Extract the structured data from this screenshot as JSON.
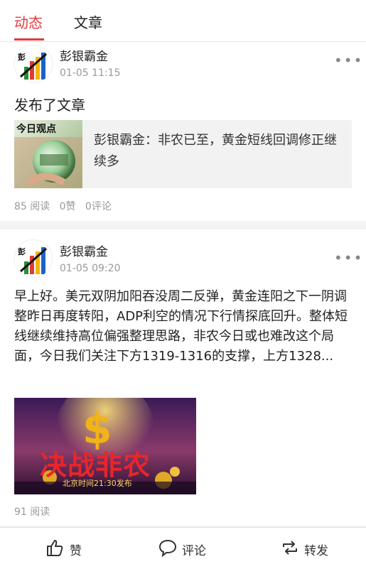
{
  "tabs": [
    {
      "label": "动态",
      "active": true
    },
    {
      "label": "文章",
      "active": false
    }
  ],
  "posts": [
    {
      "author": "彭银霸金",
      "time": "01-05 11:15",
      "action": "发布了文章",
      "article": {
        "thumb_title": "今日观点",
        "title": "彭银霸金：非农已至，黄金短线回调修正继续多"
      },
      "stats": {
        "reads": "85 阅读",
        "likes": "0赞",
        "comments": "0评论"
      }
    },
    {
      "author": "彭银霸金",
      "time": "01-05 09:20",
      "body": "早上好。美元双阴加阳吞没周二反弹，黄金连阳之下一阴调整昨日再度转阳，ADP利空的情况下行情探底回升。整体短线继续维持高位偏强整理思路，非农今日或也难改这个局面，今日我们关注下方1319-1316的支撑，上方1328...",
      "image": {
        "title": "决战非农",
        "subtitle": "北京时间21:30发布"
      },
      "stats": {
        "reads": "91 阅读"
      }
    }
  ],
  "bottom_bar": {
    "like": "赞",
    "comment": "评论",
    "share": "转发"
  },
  "colors": {
    "accent": "#e4393c"
  }
}
